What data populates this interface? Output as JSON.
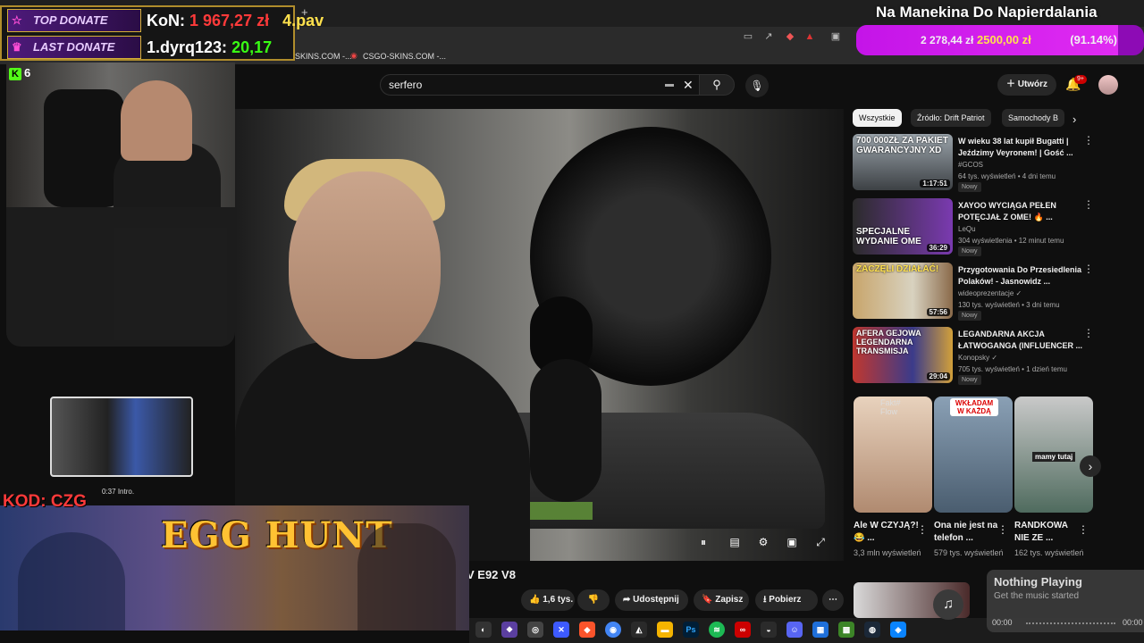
{
  "browser": {
    "new_tab_icon": "+",
    "bookmarks": [
      "SKINS.COM -...",
      "CSGO-SKINS.COM -..."
    ]
  },
  "youtube": {
    "search_value": "serfero",
    "create_label": "Utwórz",
    "notif_count": "9+"
  },
  "video": {
    "title_partial": "V E92 V8"
  },
  "actions": {
    "like": "1,6 tys.",
    "share": "Udostępnij",
    "save": "Zapisz",
    "download": "Pobierz"
  },
  "chips": [
    "Wszystkie",
    "Źródło: Drift Patriot",
    "Samochody B"
  ],
  "related": [
    {
      "thumb_text": "700 000ZŁ ZA PAKIET GWARANCYJNY XD",
      "duration": "1:17:51",
      "title": "W wieku 38 lat kupił Bugatti | Jeździmy Veyronem! | Gość ...",
      "channel": "#GCOS",
      "meta": "64 tys. wyświetleń • 4 dni temu",
      "badge": "Nowy",
      "color": "#6e7479"
    },
    {
      "thumb_text": "SPECJALNE WYDANIE OME",
      "duration": "36:29",
      "title": "XAYOO WYCIĄGA PEŁEN POTĘCJAŁ Z OME! 🔥 ...",
      "channel": "LeQu",
      "meta": "304 wyświetlenia • 12 minut temu",
      "badge": "Nowy",
      "color": "#5a3a7a"
    },
    {
      "thumb_text": "ZACZĘLI DZIAŁAĆ!",
      "duration": "57:56",
      "title": "Przygotowania Do Przesiedlenia Polaków! - Jasnowidz ...",
      "channel": "wideoprezentacje ✓",
      "meta": "130 tys. wyświetleń • 3 dni temu",
      "badge": "Nowy",
      "color": "#8a6a4a"
    },
    {
      "thumb_text": "AFERA GEJOWA LEGENDARNA TRANSMISJA",
      "duration": "29:04",
      "title": "LEGANDARNA AKCJA ŁATWOGANGA (INFLUENCER ...",
      "channel": "Konopsky ✓",
      "meta": "705 tys. wyświetleń • 1 dzień temu",
      "badge": "Nowy",
      "color": "#9a3a3a"
    }
  ],
  "shorts": [
    {
      "title": "Ale W CZYJĄ?!😂 ...",
      "views": "3,3 mln wyświetleń",
      "top_text": "Fakt# Flow",
      "color": "#c9a98f"
    },
    {
      "title": "Ona nie jest na telefon ...",
      "views": "579 tys. wyświetleń",
      "top_text": "WKŁADAM W KAŻDĄ",
      "color": "#6b7f93"
    },
    {
      "title": "RANDKOWA NIE ZE ...",
      "views": "162 tys. wyświetleń",
      "top_text": "mamy tutaj",
      "color": "#4f6b5e"
    }
  ],
  "overlay": {
    "top_donate_label": "TOP DONATE",
    "top_donate_text": "KoN: 1 967,27 zł   4.pav",
    "top_donate_name": "KoN:",
    "top_donate_amount": "1 967,27 zł",
    "top_donate_extra": "4.pav",
    "last_donate_label": "LAST DONATE",
    "last_donate_name": "1.dyrq123:",
    "last_donate_amount": "20,17",
    "stream_title": "Na Manekina Do Napierdalania",
    "goal_current": "2 278,44 zł",
    "goal_target": "2500,00 zł",
    "goal_percent": "(91.14%)",
    "goal_fraction": 0.9114,
    "kick_viewers": "6",
    "pip_time": "0:37",
    "pip_label": "Intro.",
    "promo_code": "KOD: CZG",
    "promo_title": "EGG HUNT"
  },
  "music": {
    "title": "Nothing Playing",
    "subtitle": "Get the music started",
    "time_start": "00:00",
    "time_end": "00:00"
  },
  "colors": {
    "accent_purple": "#c414e8",
    "donate_green": "#39ff14",
    "donate_red": "#ff3a3a",
    "promo_yellow": "#ffc233"
  }
}
